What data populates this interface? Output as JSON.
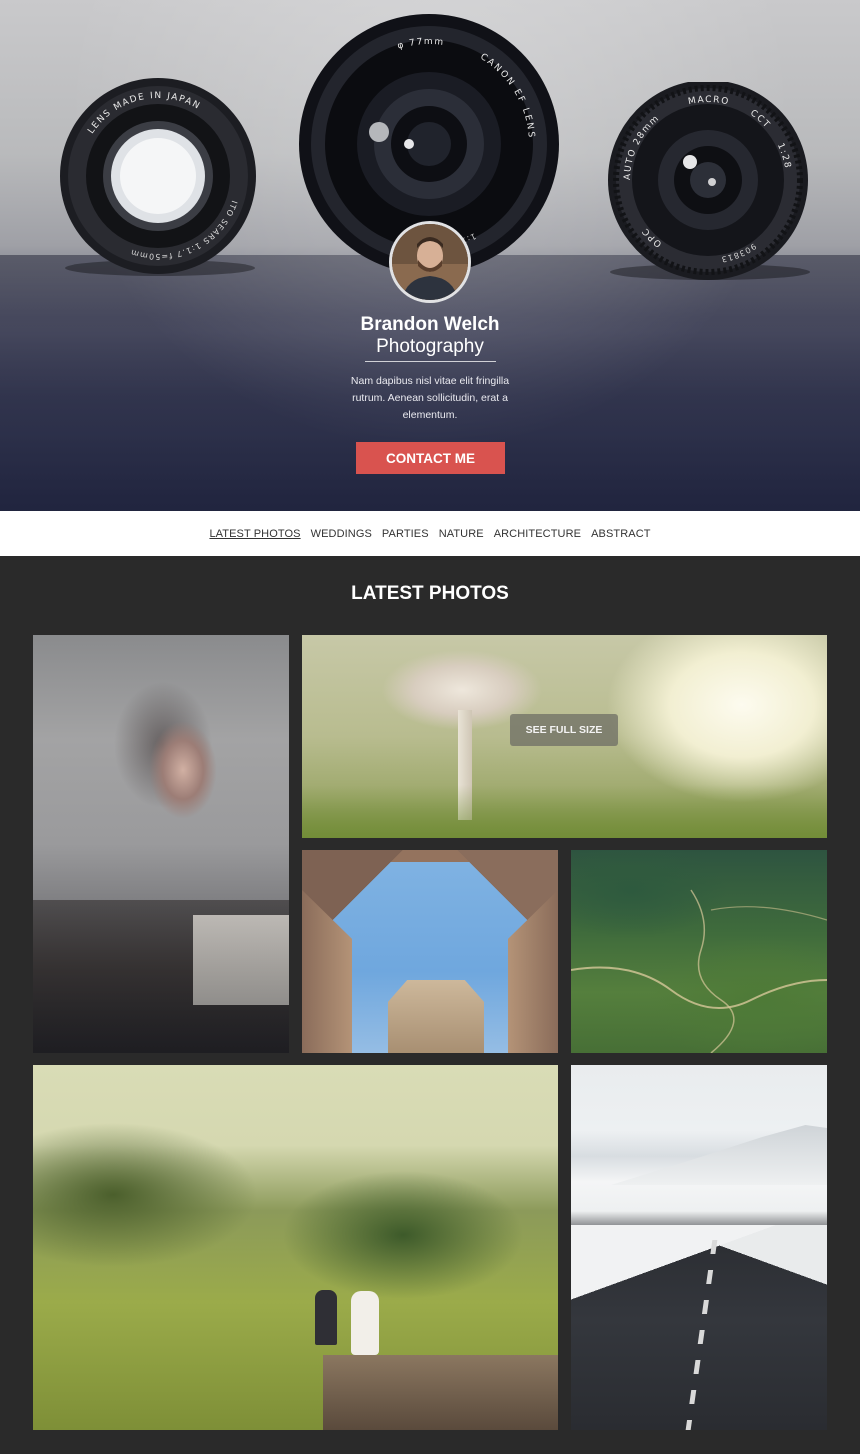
{
  "hero": {
    "name": "Brandon Welch",
    "subtitle": "Photography",
    "intro": "Nam dapibus nisl vitae elit fringilla rutrum. Aenean sollicitudin, erat a elementum.",
    "cta_label": "CONTACT ME",
    "lens_texts": {
      "left": "LENS MADE IN JAPAN",
      "left_brand": "ITO SEARS 1:1.7 f=50mm",
      "center_size": "φ 77mm",
      "center_brand": "CANON EF LENS",
      "center_ratio": "1:1.4",
      "right_top": "MACRO",
      "right_auto": "AUTO 28mm",
      "right_cct": "CCT",
      "right_ratio": "1:28",
      "right_opc": "OPC",
      "right_serial": "903813"
    }
  },
  "nav": {
    "items": [
      {
        "label": "LATEST PHOTOS",
        "active": true
      },
      {
        "label": "WEDDINGS",
        "active": false
      },
      {
        "label": "PARTIES",
        "active": false
      },
      {
        "label": "NATURE",
        "active": false
      },
      {
        "label": "ARCHITECTURE",
        "active": false
      },
      {
        "label": "ABSTRACT",
        "active": false
      }
    ]
  },
  "gallery": {
    "title": "LATEST PHOTOS",
    "overlay_label": "SEE FULL SIZE"
  },
  "colors": {
    "accent": "#d9534f",
    "gallery_bg": "#2a2a2a"
  }
}
